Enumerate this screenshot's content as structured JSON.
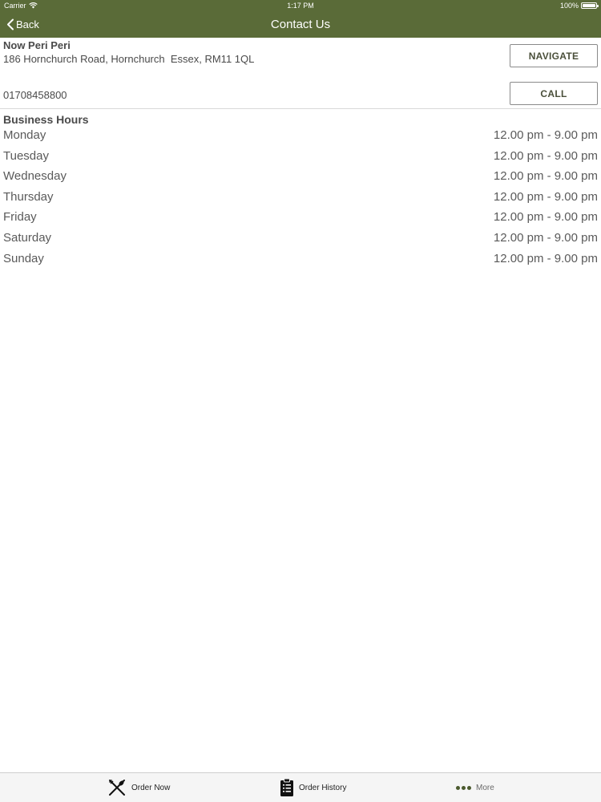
{
  "status_bar": {
    "carrier": "Carrier",
    "time": "1:17 PM",
    "battery": "100%"
  },
  "navbar": {
    "back_label": "Back",
    "title": "Contact Us",
    "color": "#5a6b38"
  },
  "contact": {
    "name": "Now Peri Peri",
    "address": "186 Hornchurch Road, Hornchurch  Essex, RM11 1QL",
    "phone": "01708458800",
    "navigate_label": "NAVIGATE",
    "call_label": "CALL"
  },
  "hours": {
    "title": "Business Hours",
    "days": [
      {
        "day": "Monday",
        "time": "12.00 pm - 9.00 pm"
      },
      {
        "day": "Tuesday",
        "time": "12.00 pm - 9.00 pm"
      },
      {
        "day": "Wednesday",
        "time": "12.00 pm - 9.00 pm"
      },
      {
        "day": "Thursday",
        "time": "12.00 pm - 9.00 pm"
      },
      {
        "day": "Friday",
        "time": "12.00 pm - 9.00 pm"
      },
      {
        "day": "Saturday",
        "time": "12.00 pm - 9.00 pm"
      },
      {
        "day": "Sunday",
        "time": "12.00 pm - 9.00 pm"
      }
    ]
  },
  "tabbar": {
    "tabs": [
      {
        "label": "Order Now",
        "icon": "utensils-icon"
      },
      {
        "label": "Order History",
        "icon": "clipboard-icon"
      },
      {
        "label": "More",
        "icon": "more-dots-icon"
      }
    ]
  }
}
